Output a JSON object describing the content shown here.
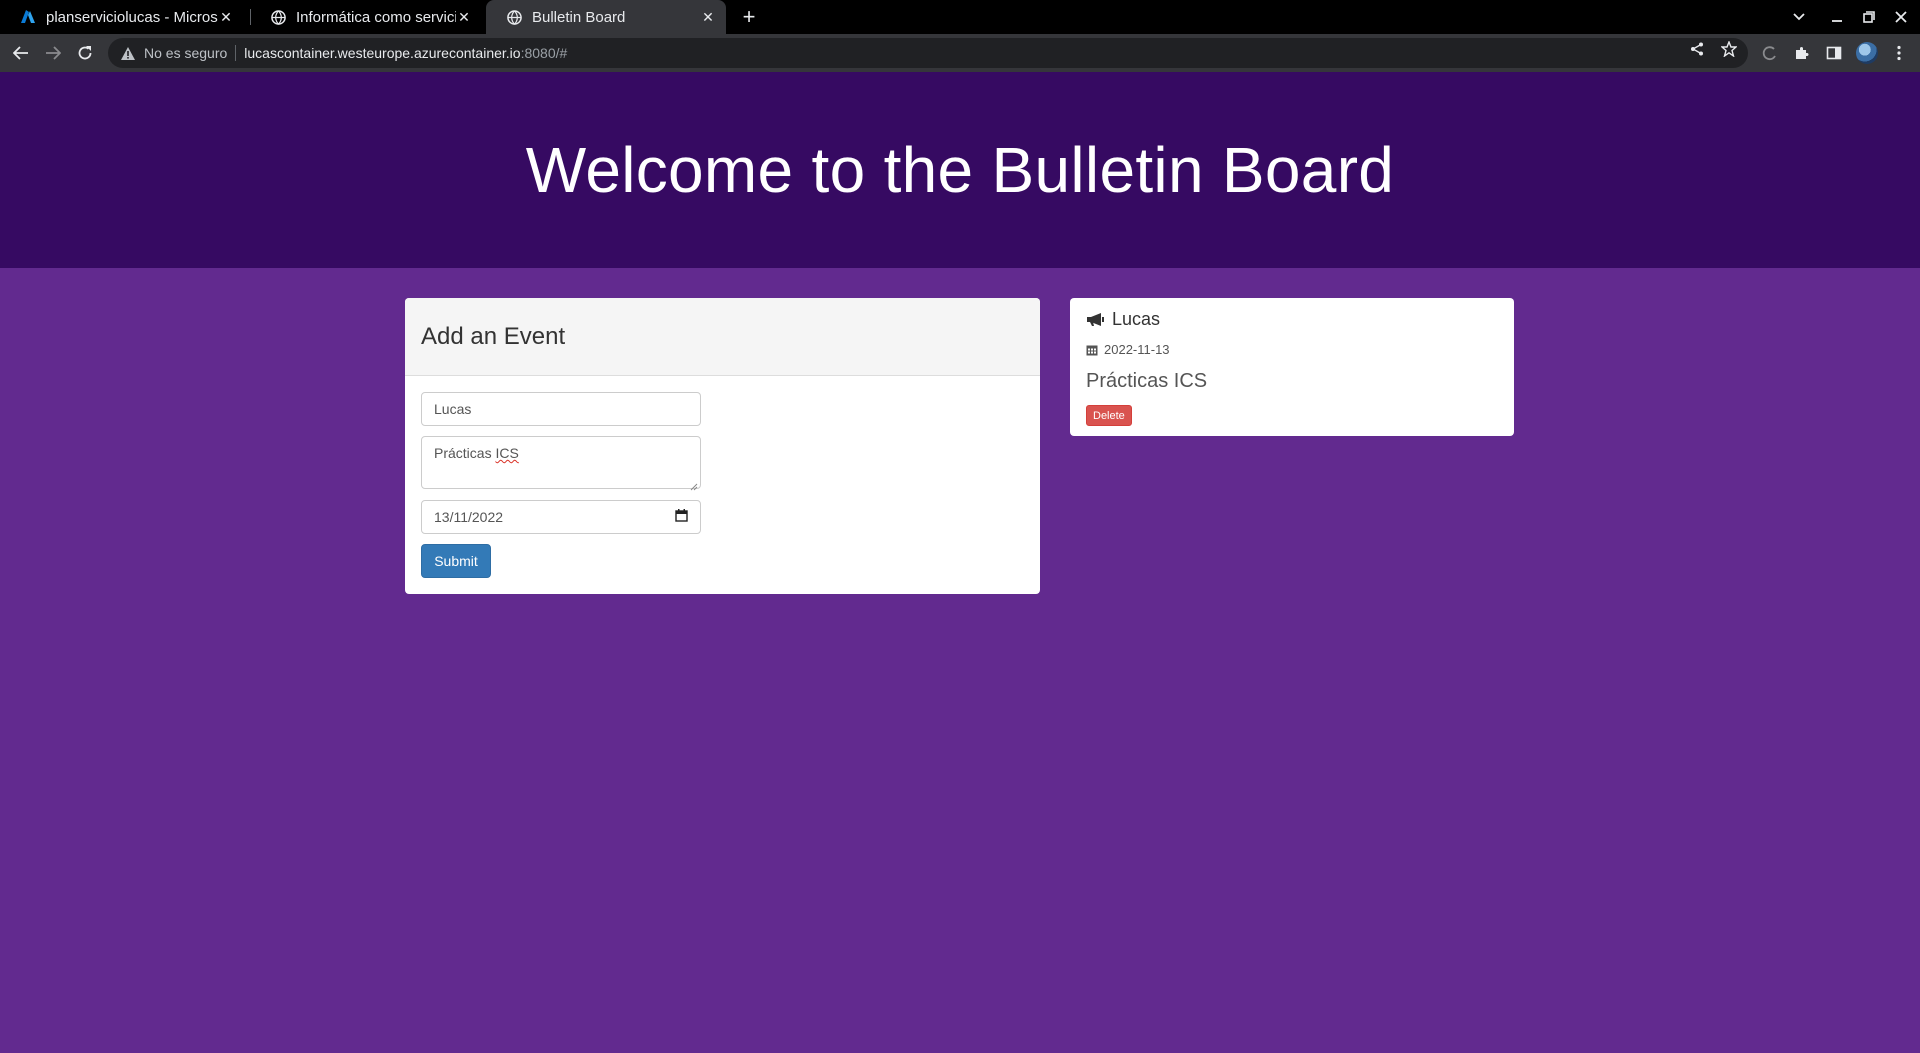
{
  "browser": {
    "tabs": [
      {
        "title": "planserviciolucas - Micros",
        "icon": "azure-icon",
        "active": false
      },
      {
        "title": "Informática como servicio",
        "icon": "globe-icon",
        "active": false
      },
      {
        "title": "Bulletin Board",
        "icon": "globe-icon",
        "active": true
      }
    ],
    "security_label": "No es seguro",
    "url_host": "lucascontainer.westeurope.azurecontainer.io",
    "url_rest": ":8080/#"
  },
  "page": {
    "title": "Welcome to the Bulletin Board"
  },
  "form": {
    "heading": "Add an Event",
    "name_value": "Lucas",
    "description_prefix": "Prácticas ",
    "description_flagged": "ICS",
    "date_value": "13/11/2022",
    "submit_label": "Submit"
  },
  "events": [
    {
      "name": "Lucas",
      "date": "2022-11-13",
      "description": "Prácticas ICS",
      "delete_label": "Delete"
    }
  ],
  "colors": {
    "page_background": "#622a8f",
    "header_background": "#360a62",
    "submit_button": "#337ab7",
    "delete_button": "#d9534f"
  }
}
